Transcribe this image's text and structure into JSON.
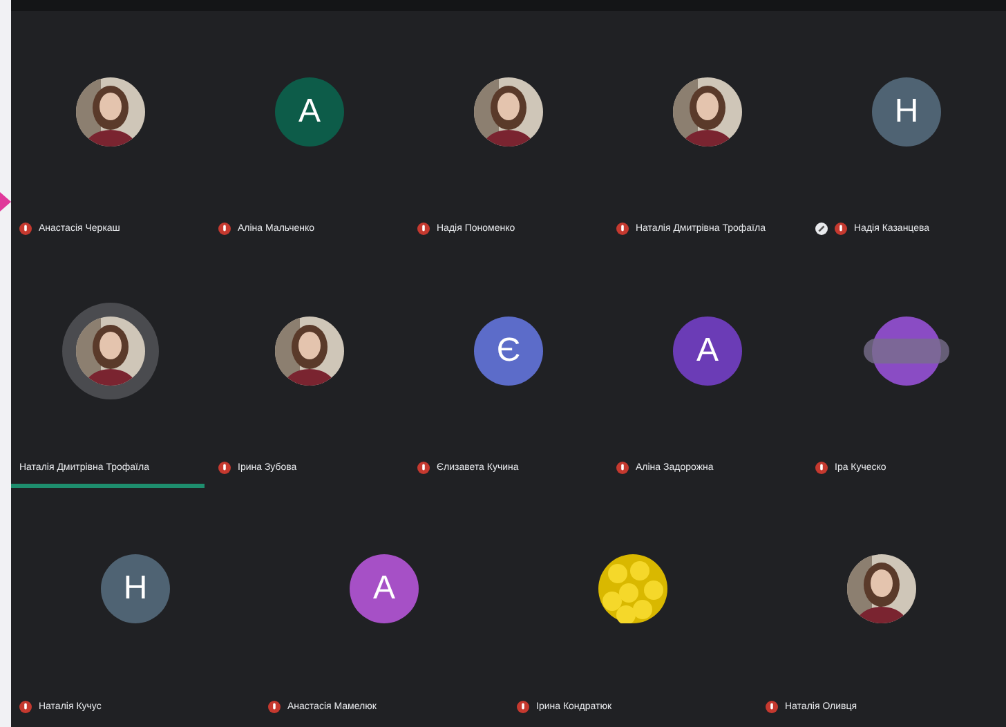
{
  "rows": [
    {
      "tiles": [
        {
          "name": "Анастасія Черкаш",
          "muted": true,
          "pinned": false,
          "speaking": false
        },
        {
          "name": "Аліна Мальченко",
          "avatar": {
            "kind": "letter",
            "letter": "A",
            "color": "#0d5c49"
          },
          "muted": true,
          "pinned": false,
          "speaking": false
        },
        {
          "name": "Надія Пономенко",
          "muted": true,
          "pinned": false,
          "speaking": false
        },
        {
          "name": "Наталія Дмитрівна Трофаїла",
          "muted": true,
          "pinned": false,
          "speaking": false
        },
        {
          "name": "Надія Казанцева",
          "avatar": {
            "kind": "letter",
            "letter": "H",
            "color": "#4f6373"
          },
          "muted": true,
          "pinned": true,
          "speaking": false
        }
      ]
    },
    {
      "tiles": [
        {
          "name": "Наталія Дмитрівна Трофаїла",
          "muted": false,
          "pinned": false,
          "speaking": true
        },
        {
          "name": "Ірина Зубова",
          "muted": true,
          "pinned": false,
          "speaking": false
        },
        {
          "name": "Єлизавета Кучина",
          "avatar": {
            "kind": "letter",
            "letter": "Є",
            "color": "#5c6cc9"
          },
          "muted": true,
          "pinned": false,
          "speaking": false
        },
        {
          "name": "Аліна Задорожна",
          "avatar": {
            "kind": "letter",
            "letter": "A",
            "color": "#6b3cb6"
          },
          "muted": true,
          "pinned": false,
          "speaking": false
        },
        {
          "name": "Іра Куческо",
          "avatar": {
            "kind": "blank",
            "color": "#8a4cc4"
          },
          "muted": true,
          "pinned": false,
          "speaking": false
        }
      ]
    },
    {
      "tiles": [
        {
          "name": "Наталія Кучус",
          "avatar": {
            "kind": "letter",
            "letter": "H",
            "color": "#4f6373"
          },
          "muted": true,
          "pinned": false,
          "speaking": false
        },
        {
          "name": "Анастасія Мамелюк",
          "avatar": {
            "kind": "letter",
            "letter": "A",
            "color": "#a650c6"
          },
          "muted": true,
          "pinned": false,
          "speaking": false
        },
        {
          "name": "Ірина Кондратюк",
          "muted": true,
          "pinned": false,
          "speaking": false
        },
        {
          "name": "Наталія Оливця",
          "muted": true,
          "pinned": false,
          "speaking": false
        }
      ]
    }
  ]
}
